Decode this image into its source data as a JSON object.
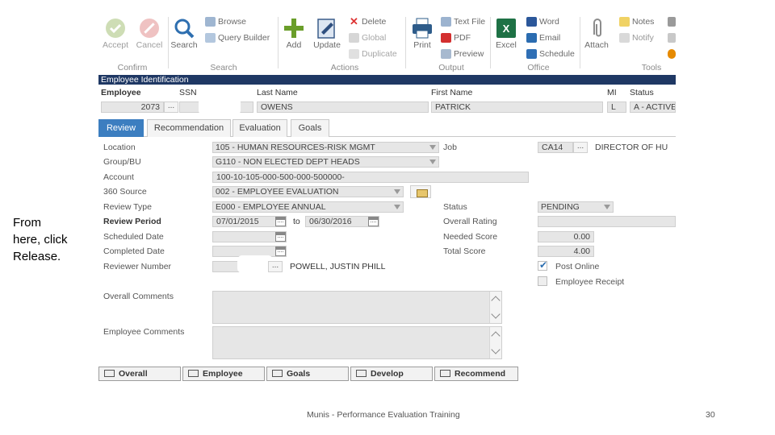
{
  "caption": {
    "line1": "From",
    "line2": "here, click",
    "line3": "Release."
  },
  "ribbon": {
    "confirm": {
      "label": "Confirm",
      "accept": "Accept",
      "cancel": "Cancel"
    },
    "search": {
      "label": "Search",
      "search": "Search",
      "browse": "Browse",
      "query_builder": "Query Builder"
    },
    "actions": {
      "label": "Actions",
      "add": "Add",
      "update": "Update",
      "delete": "Delete",
      "global": "Global",
      "duplicate": "Duplicate"
    },
    "output": {
      "label": "Output",
      "print": "Print",
      "text_file": "Text File",
      "pdf": "PDF",
      "preview": "Preview"
    },
    "office": {
      "label": "Office",
      "excel": "Excel",
      "word": "Word",
      "email": "Email",
      "schedule": "Schedule"
    },
    "tools": {
      "label": "Tools",
      "attach": "Attach",
      "notes": "Notes",
      "notify": "Notify"
    }
  },
  "employee_identification": {
    "title": "Employee Identification",
    "labels": {
      "employee": "Employee",
      "ssn": "SSN",
      "last_name": "Last Name",
      "first_name": "First Name",
      "mi": "MI",
      "status": "Status"
    },
    "values": {
      "employee": "2073",
      "last_name": "OWENS",
      "first_name": "PATRICK",
      "mi": "L",
      "status": "A - ACTIVE"
    }
  },
  "tabs": [
    {
      "label": "Review",
      "active": true
    },
    {
      "label": "Recommendation",
      "active": false
    },
    {
      "label": "Evaluation",
      "active": false
    },
    {
      "label": "Goals",
      "active": false
    }
  ],
  "review": {
    "location": {
      "label": "Location",
      "value": "105 - HUMAN RESOURCES-RISK MGMT"
    },
    "job": {
      "label": "Job",
      "code": "CA14",
      "desc": "DIRECTOR OF HU"
    },
    "group_bu": {
      "label": "Group/BU",
      "value": "G110 - NON ELECTED DEPT HEADS"
    },
    "account": {
      "label": "Account",
      "value": "100-10-105-000-500-000-500000-"
    },
    "source_360": {
      "label": "360 Source",
      "value": "002 - EMPLOYEE EVALUATION"
    },
    "review_type": {
      "label": "Review Type",
      "value": "E000 - EMPLOYEE ANNUAL"
    },
    "status": {
      "label": "Status",
      "value": "PENDING"
    },
    "review_period": {
      "label": "Review Period",
      "start": "07/01/2015",
      "to": "to",
      "end": "06/30/2016"
    },
    "overall_rating": {
      "label": "Overall Rating",
      "value": ""
    },
    "scheduled_date": {
      "label": "Scheduled Date"
    },
    "needed_score": {
      "label": "Needed Score",
      "value": "0.00"
    },
    "completed_date": {
      "label": "Completed Date"
    },
    "total_score": {
      "label": "Total Score",
      "value": "4.00"
    },
    "reviewer_number": {
      "label": "Reviewer Number",
      "name": "POWELL, JUSTIN PHILL"
    },
    "post_online": {
      "label": "Post Online",
      "checked": true
    },
    "employee_receipt": {
      "label": "Employee Receipt",
      "checked": false
    },
    "overall_comments": {
      "label": "Overall Comments"
    },
    "employee_comments": {
      "label": "Employee Comments"
    }
  },
  "bottom_buttons": [
    "Overall",
    "Employee",
    "Goals",
    "Develop",
    "Recommend"
  ],
  "footer": {
    "text": "Munis - Performance Evaluation Training",
    "page": "30"
  },
  "colors": {
    "section_header": "#1f3864",
    "active_tab": "#3c7ec0",
    "accept_green": "#8bc34a",
    "cancel_red": "#e57373"
  }
}
